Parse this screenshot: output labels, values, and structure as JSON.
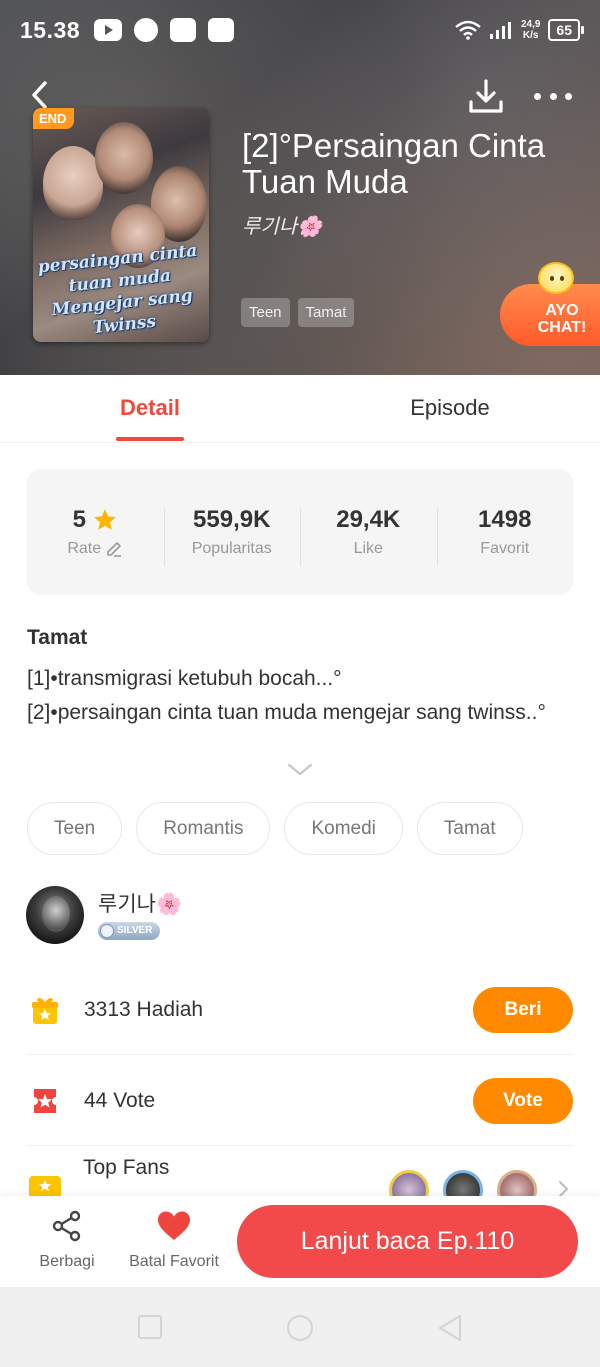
{
  "status_bar": {
    "time": "15.38",
    "net_speed_value": "24,9",
    "net_speed_unit": "K/s",
    "battery": "65"
  },
  "book": {
    "badge": "END",
    "cover_text_line1": "persaingan cinta tuan muda",
    "cover_text_line2": "Mengejar sang Twinss",
    "title": "[2]°Persaingan Cinta Tuan Muda",
    "author": "루기나🌸",
    "header_tags": [
      "Teen",
      "Tamat"
    ]
  },
  "ayo_chat": {
    "line1": "AYO",
    "line2": "CHAT!"
  },
  "tabs": {
    "detail": "Detail",
    "episode": "Episode"
  },
  "stats": {
    "rate_value": "5",
    "rate_label": "Rate",
    "popularity_value": "559,9K",
    "popularity_label": "Popularitas",
    "like_value": "29,4K",
    "like_label": "Like",
    "favorite_value": "1498",
    "favorite_label": "Favorit"
  },
  "description": {
    "status": "Tamat",
    "line1": "[1]•transmigrasi ketubuh bocah...°",
    "line2": "[2]•persaingan cinta tuan muda mengejar sang twinss..°"
  },
  "genres": [
    "Teen",
    "Romantis",
    "Komedi",
    "Tamat"
  ],
  "author_row": {
    "name": "루기나🌸",
    "badge": "SILVER"
  },
  "gift_row": {
    "text": "3313  Hadiah",
    "button": "Beri"
  },
  "vote_row": {
    "text": "44  Vote",
    "button": "Vote"
  },
  "top_fans": {
    "title": "Top Fans"
  },
  "bottom_bar": {
    "share_label": "Berbagi",
    "unfavorite_label": "Batal Favorit",
    "read_button": "Lanjut baca Ep.110"
  },
  "colors": {
    "accent_red": "#f04a3f",
    "read_button": "#f24a4a",
    "orange_button": "#ff8a00",
    "end_badge": "#ff9a1f",
    "star": "#ffb400"
  }
}
